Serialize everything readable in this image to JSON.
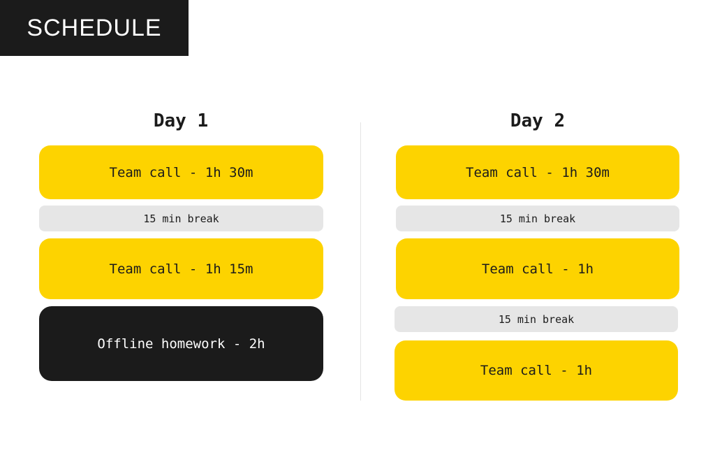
{
  "header": {
    "title": "SCHEDULE"
  },
  "colors": {
    "call": "#fdd300",
    "break": "#e6e6e6",
    "homework": "#1b1b1b",
    "header_bg": "#1b1b1b"
  },
  "days": [
    {
      "title": "Day 1",
      "blocks": [
        {
          "type": "call",
          "label": "Team call - 1h 30m"
        },
        {
          "type": "break",
          "label": "15 min break"
        },
        {
          "type": "call",
          "label": "Team call - 1h 15m"
        },
        {
          "type": "homework",
          "label": "Offline homework - 2h"
        }
      ]
    },
    {
      "title": "Day 2",
      "blocks": [
        {
          "type": "call",
          "label": "Team call - 1h 30m"
        },
        {
          "type": "break",
          "label": "15 min break"
        },
        {
          "type": "call",
          "label": "Team call - 1h"
        },
        {
          "type": "break",
          "label": "15 min break"
        },
        {
          "type": "call",
          "label": "Team call - 1h"
        }
      ]
    }
  ]
}
